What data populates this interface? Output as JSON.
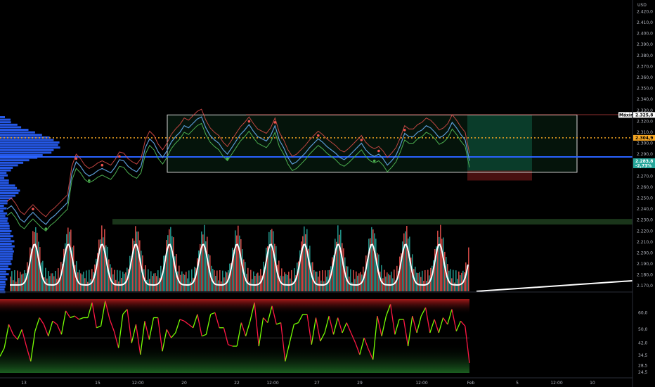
{
  "currency_label": "USD",
  "maximo_label": "Máximo",
  "maximo_value": "2.325,8",
  "orange_tag": "2.304,9",
  "green_tag": "2.283,8",
  "green_tag_sub": "-2,73%",
  "colors": {
    "price_up": "#26a69a",
    "price_down": "#ef5350",
    "box_border": "#d9d9d9",
    "box_fill": "#0d3a1f",
    "poc_line": "#2962ff",
    "orange_line": "#f5a623",
    "profile": "#2962ff",
    "supertrend_up": "#4caf50",
    "supertrend_down": "#ef5350",
    "white_curve": "#ffffff"
  },
  "chart_data": [
    {
      "type": "line",
      "panel": "price",
      "y_ticks": [
        "2.420,0",
        "2.410,0",
        "2.400,0",
        "2.390,0",
        "2.380,0",
        "2.370,0",
        "2.360,0",
        "2.350,0",
        "2.340,0",
        "2.330,0",
        "2.320,0",
        "2.310,0",
        "2.300,0",
        "2.290,0",
        "2.280,0",
        "2.270,0",
        "2.260,0",
        "2.250,0",
        "2.240,0",
        "2.230,0",
        "2.220,0",
        "2.210,0",
        "2.200,0",
        "2.190,0",
        "2.180,0",
        "2.170,0"
      ],
      "ylim": [
        2165,
        2428
      ],
      "range_box": {
        "top": 2325.8,
        "bottom": 2273.5
      },
      "poc_level": 2287.5,
      "orange_level": 2304.9,
      "series": [
        {
          "values": [
            2240,
            2243,
            2238,
            2231,
            2228,
            2233,
            2237,
            2233,
            2229,
            2226,
            2231,
            2234,
            2238,
            2242,
            2246,
            2272,
            2283,
            2279,
            2273,
            2270,
            2272,
            2275,
            2277,
            2275,
            2273,
            2278,
            2285,
            2284,
            2279,
            2276,
            2274,
            2279,
            2296,
            2304,
            2300,
            2292,
            2287,
            2293,
            2301,
            2306,
            2310,
            2316,
            2314,
            2318,
            2322,
            2324,
            2314,
            2307,
            2303,
            2300,
            2294,
            2290,
            2296,
            2302,
            2308,
            2312,
            2317,
            2311,
            2306,
            2304,
            2302,
            2307,
            2316,
            2303,
            2296,
            2287,
            2281,
            2283,
            2287,
            2291,
            2296,
            2300,
            2304,
            2301,
            2297,
            2294,
            2291,
            2287,
            2285,
            2288,
            2292,
            2296,
            2300,
            2294,
            2290,
            2288,
            2290,
            2286,
            2280,
            2284,
            2289,
            2298,
            2309,
            2306,
            2306,
            2310,
            2312,
            2316,
            2314,
            2310,
            2305,
            2307,
            2311,
            2319,
            2314,
            2308,
            2303,
            2284
          ]
        }
      ]
    },
    {
      "type": "line",
      "panel": "oscillator",
      "y_ticks": [
        "60,0",
        "50,0",
        "42,0",
        "34,5",
        "28,5",
        "24,5"
      ],
      "ylim": [
        22,
        66
      ],
      "series": [
        {
          "values": [
            34,
            39,
            53,
            47,
            44,
            50,
            40,
            31,
            49,
            57,
            53,
            46,
            55,
            53,
            47,
            61,
            57,
            58,
            56,
            57,
            57,
            66,
            51,
            52,
            67,
            56,
            49,
            39,
            59,
            62,
            42,
            53,
            35,
            55,
            44,
            57,
            57,
            37,
            50,
            45,
            48,
            56,
            55,
            53,
            51,
            59,
            46,
            47,
            59,
            60,
            51,
            51,
            41,
            40,
            40,
            54,
            46,
            55,
            66,
            40,
            57,
            54,
            64,
            53,
            54,
            31,
            42,
            53,
            54,
            59,
            59,
            41,
            57,
            43,
            48,
            58,
            47,
            57,
            48,
            54,
            48,
            42,
            35,
            45,
            38,
            32,
            58,
            46,
            58,
            65,
            47,
            56,
            56,
            40,
            58,
            48,
            58,
            63,
            48,
            56,
            48,
            57,
            53,
            62,
            49,
            55,
            52,
            30
          ]
        }
      ]
    }
  ],
  "x_axis_labels": [
    "13",
    "15",
    "12:00",
    "20",
    "22",
    "12:00",
    "27",
    "29",
    "12:00",
    "Feb",
    "5",
    "12:00",
    "10"
  ]
}
